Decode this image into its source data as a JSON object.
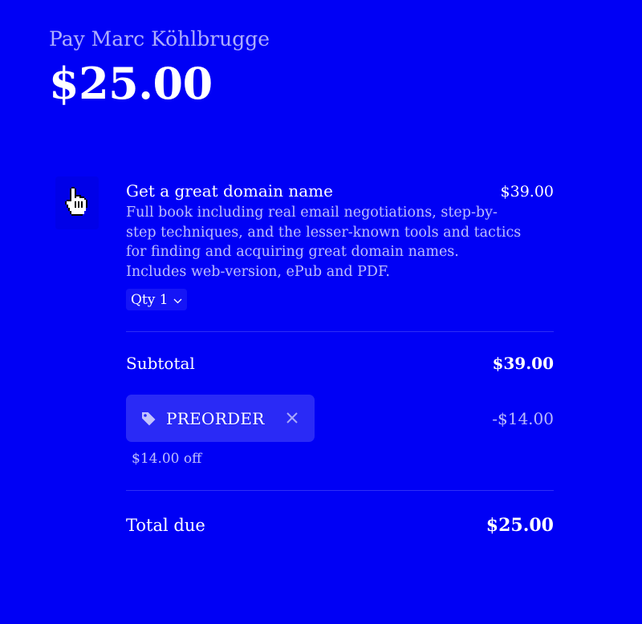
{
  "header": {
    "pay_to": "Pay Marc Köhlbrugge",
    "amount": "$25.00"
  },
  "line_item": {
    "icon": "pointer-hand-icon",
    "name": "Get a great domain name",
    "price": "$39.00",
    "description": "Full book including real email negotiations, step-by-step techniques, and the lesser-known tools and tactics for finding and acquiring great domain names. Includes web-version, ePub and PDF.",
    "qty_label": "Qty 1"
  },
  "subtotal": {
    "label": "Subtotal",
    "value": "$39.00"
  },
  "promo": {
    "code": "PREORDER",
    "discount": "-$14.00",
    "note": "$14.00 off"
  },
  "total": {
    "label": "Total due",
    "value": "$25.00"
  },
  "colors": {
    "background": "#0000f5",
    "promo_chip": "#2a2af6",
    "text": "#ffffff"
  }
}
